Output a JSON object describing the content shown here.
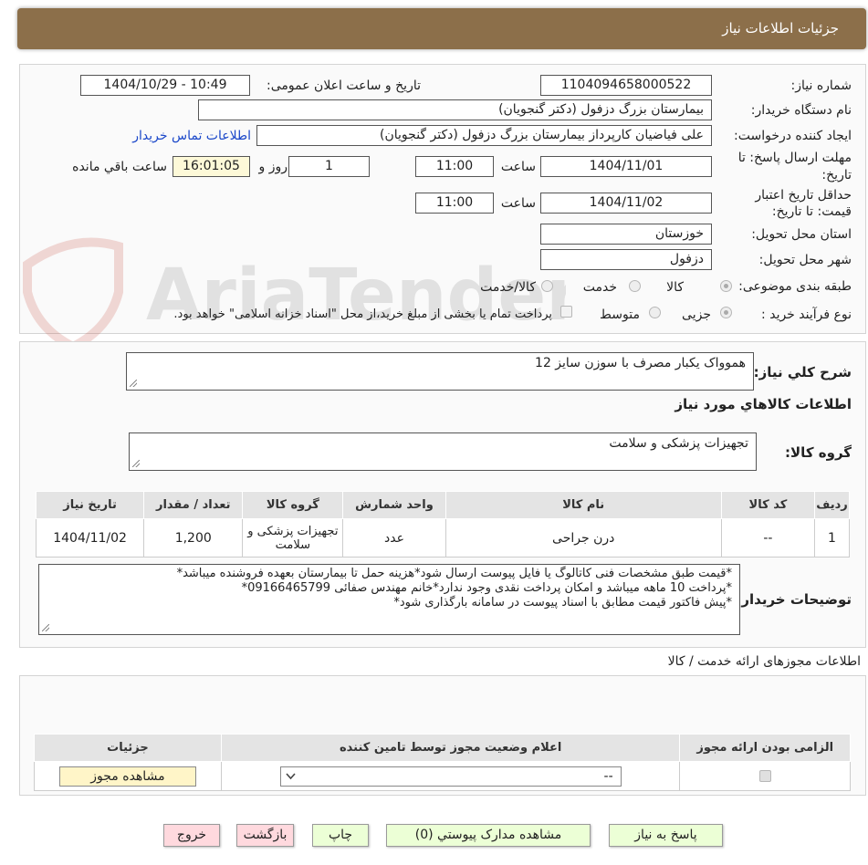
{
  "header": {
    "title": "جزئیات اطلاعات نیاز"
  },
  "form": {
    "need_number_label": "شماره نیاز:",
    "need_number": "1104094658000522",
    "announce_label": "تاریخ و ساعت اعلان عمومی:",
    "announce_value": "1404/10/29 - 10:49",
    "buyer_org_label": "نام دستگاه خریدار:",
    "buyer_org": "بیمارستان بزرگ دزفول (دکتر گنجویان)",
    "requester_label": "ایجاد کننده درخواست:",
    "requester": "علی فیاضیان کارپرداز بیمارستان بزرگ دزفول (دکتر گنجویان)",
    "contact_link": "اطلاعات تماس خریدار",
    "deadline_label_1": "مهلت ارسال پاسخ: تا",
    "deadline_label_2": "تاریخ:",
    "deadline_date": "1404/11/01",
    "time_label": "ساعت",
    "deadline_time": "11:00",
    "days_value": "1",
    "days_label": "روز و",
    "remaining_time": "16:01:05",
    "remaining_label": "ساعت باقي مانده",
    "validity_label_1": "حداقل تاریخ اعتبار",
    "validity_label_2": "قیمت: تا تاریخ:",
    "validity_date": "1404/11/02",
    "validity_time": "11:00",
    "province_label": "استان محل تحویل:",
    "province": "خوزستان",
    "city_label": "شهر محل تحویل:",
    "city": "دزفول",
    "category_label": "طبقه بندی موضوعی:",
    "category_options": [
      "کالا",
      "خدمت",
      "کالا/خدمت"
    ],
    "process_label": "نوع فرآیند خرید :",
    "process_options": [
      "جزیی",
      "متوسط"
    ],
    "payment_note": "پرداخت تمام یا بخشی از مبلغ خرید،از محل \"اسناد خزانه اسلامی\" خواهد بود."
  },
  "watermark": {
    "text": "AriaTender.neT"
  },
  "details": {
    "summary_label": "شرح کلي نياز:",
    "summary": "هموواک یکبار مصرف با سوزن سایز 12",
    "goods_info_title": "اطلاعات کالاهاي مورد نياز",
    "group_label": "گروه کالا:",
    "group_value": "تجهیزات پزشکی و سلامت",
    "table": {
      "headers": [
        "رديف",
        "کد کالا",
        "نام کالا",
        "واحد شمارش",
        "گروه کالا",
        "تعداد / مقدار",
        "تاریخ نیاز"
      ],
      "rows": [
        [
          "1",
          "--",
          "درن جراحی",
          "عدد",
          "تجهیزات پزشکی و سلامت",
          "1,200",
          "1404/11/02"
        ]
      ]
    },
    "buyer_notes_label": "توضیحات خریدار:",
    "buyer_notes": [
      "*قیمت طبق مشخصات فنی کاتالوگ یا فایل پیوست ارسال شود*هزینه حمل تا بیمارستان بعهده فروشنده میباشد*",
      "*پرداخت 10 ماهه میباشد و امکان پرداخت نقدی وجود ندارد*خانم مهندس صفائی 09166465799*",
      "*پیش فاکتور قیمت مطابق با اسناد پیوست در سامانه بارگذاری شود*"
    ]
  },
  "permits": {
    "title": "اطلاعات مجوزهای ارائه خدمت / کالا",
    "headers": [
      "الزامی بودن ارائه مجوز",
      "اعلام وضعیت مجوز توسط تامین کننده",
      "جزئیات"
    ],
    "select_value": "--",
    "view_button": "مشاهده مجوز"
  },
  "buttons": {
    "reply": "پاسخ به نیاز",
    "attachments": "مشاهده مدارک پیوستي (0)",
    "print": "چاپ",
    "back": "بازگشت",
    "exit": "خروج"
  },
  "colors": {
    "header_bg": "#8c6f4a",
    "button_bg": "#ecffd6",
    "button_danger_bg": "#ffd9de",
    "link": "#1a47c9"
  }
}
